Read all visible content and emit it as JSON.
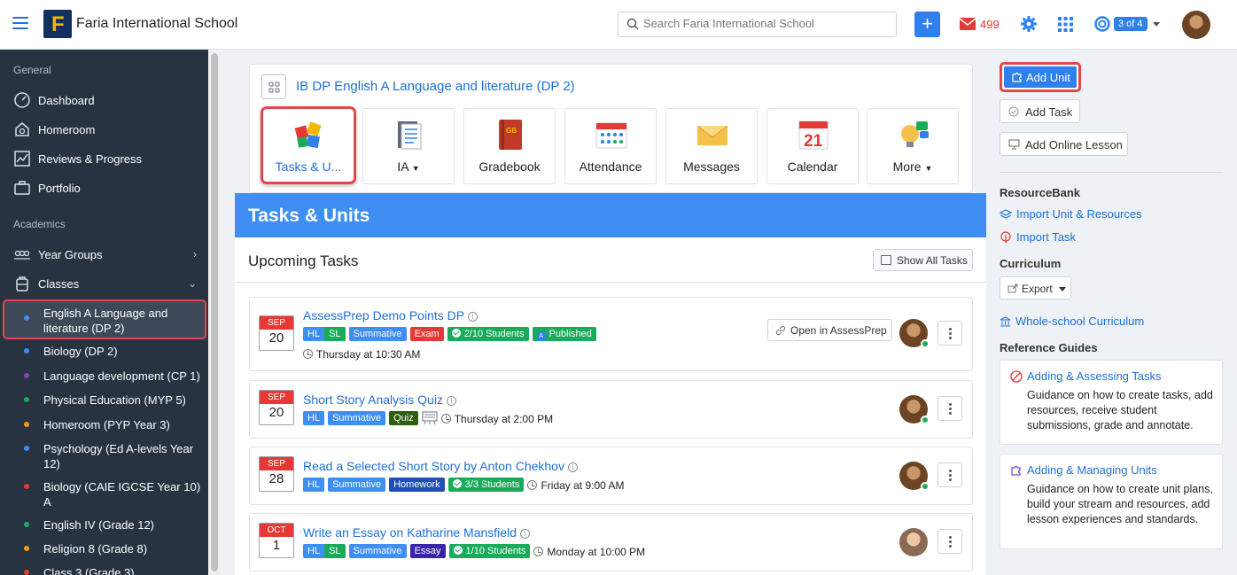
{
  "header": {
    "school_name": "Faria International School",
    "search_placeholder": "Search Faria International School",
    "mail_count": "499",
    "help_pager": "3 of 4"
  },
  "sidebar": {
    "section_general": "General",
    "general_items": [
      {
        "label": "Dashboard",
        "icon": "dashboard-icon"
      },
      {
        "label": "Homeroom",
        "icon": "homeroom-icon"
      },
      {
        "label": "Reviews & Progress",
        "icon": "chart-icon"
      },
      {
        "label": "Portfolio",
        "icon": "briefcase-icon"
      }
    ],
    "section_academics": "Academics",
    "academic_items": [
      {
        "label": "Year Groups",
        "icon": "people-icon"
      },
      {
        "label": "Classes",
        "icon": "backpack-icon"
      }
    ],
    "classes": [
      {
        "label": "English A Language and literature (DP 2)",
        "color": "#3e8ef4"
      },
      {
        "label": "Biology (DP 2)",
        "color": "#3e8ef4"
      },
      {
        "label": "Language development (CP 1)",
        "color": "#8e44ad"
      },
      {
        "label": "Physical Education (MYP 5)",
        "color": "#1aab5a"
      },
      {
        "label": "Homeroom (PYP Year 3)",
        "color": "#f39c12"
      },
      {
        "label": "Psychology (Ed A-levels Year 12)",
        "color": "#3e8ef4"
      },
      {
        "label": "Biology (CAIE IGCSE Year 10) A",
        "color": "#e53935"
      },
      {
        "label": "English IV (Grade 12)",
        "color": "#1aab5a"
      },
      {
        "label": "Religion 8 (Grade 8)",
        "color": "#f39c12"
      },
      {
        "label": "Class 3 (Grade 3)",
        "color": "#e53935"
      }
    ]
  },
  "class_header": {
    "title": "IB DP English A Language and literature (DP 2)",
    "tiles": [
      {
        "label": "Tasks & U...",
        "icon": "puzzle-icon"
      },
      {
        "label": "IA",
        "icon": "clipboard-icon"
      },
      {
        "label": "Gradebook",
        "icon": "gradebook-icon"
      },
      {
        "label": "Attendance",
        "icon": "attendance-icon"
      },
      {
        "label": "Messages",
        "icon": "envelope-icon"
      },
      {
        "label": "Calendar",
        "icon": "calendar-icon"
      },
      {
        "label": "More",
        "icon": "lightbulb-icon"
      }
    ],
    "calendar_day": "21"
  },
  "main": {
    "banner_title": "Tasks & Units",
    "upcoming_title": "Upcoming Tasks",
    "show_all_label": "Show All Tasks",
    "tasks": [
      {
        "month": "SEP",
        "day": "20",
        "title": "AssessPrep Demo Points DP",
        "tags": [
          "HL",
          "SL",
          "Summative",
          "Exam",
          "2/10 Students",
          "Published"
        ],
        "time": "Thursday at 10:30 AM",
        "open_label": "Open in AssessPrep"
      },
      {
        "month": "SEP",
        "day": "20",
        "title": "Short Story Analysis Quiz",
        "tags": [
          "HL",
          "Summative",
          "Quiz"
        ],
        "time": "Thursday at 2:00 PM"
      },
      {
        "month": "SEP",
        "day": "28",
        "title": "Read a Selected Short Story by Anton Chekhov",
        "tags": [
          "HL",
          "Summative",
          "Homework",
          "3/3 Students"
        ],
        "time": "Friday at 9:00 AM"
      },
      {
        "month": "OCT",
        "day": "1",
        "title": "Write an Essay on Katharine Mansfield",
        "tags": [
          "HL",
          "SL",
          "Summative",
          "Essay",
          "1/10 Students"
        ],
        "time": "Monday at 10:00 PM"
      }
    ]
  },
  "right_panel": {
    "add_unit": "Add Unit",
    "add_task": "Add Task",
    "add_online_lesson": "Add Online Lesson",
    "resource_bank": "ResourceBank",
    "import_unit": "Import Unit & Resources",
    "import_task": "Import Task",
    "curriculum": "Curriculum",
    "export": "Export",
    "whole_school": "Whole-school Curriculum",
    "reference_guides": "Reference Guides",
    "guides": [
      {
        "title": "Adding & Assessing Tasks",
        "desc": "Guidance on how to create tasks, add resources, receive student submissions, grade and annotate."
      },
      {
        "title": "Adding & Managing Units",
        "desc": "Guidance on how to create unit plans, build your stream and resources, add lesson experiences and standards."
      }
    ]
  },
  "colors": {
    "accent": "#2f80ed",
    "banner": "#3e8ef4",
    "sidebar": "#283341",
    "highlight": "#e6454c"
  }
}
